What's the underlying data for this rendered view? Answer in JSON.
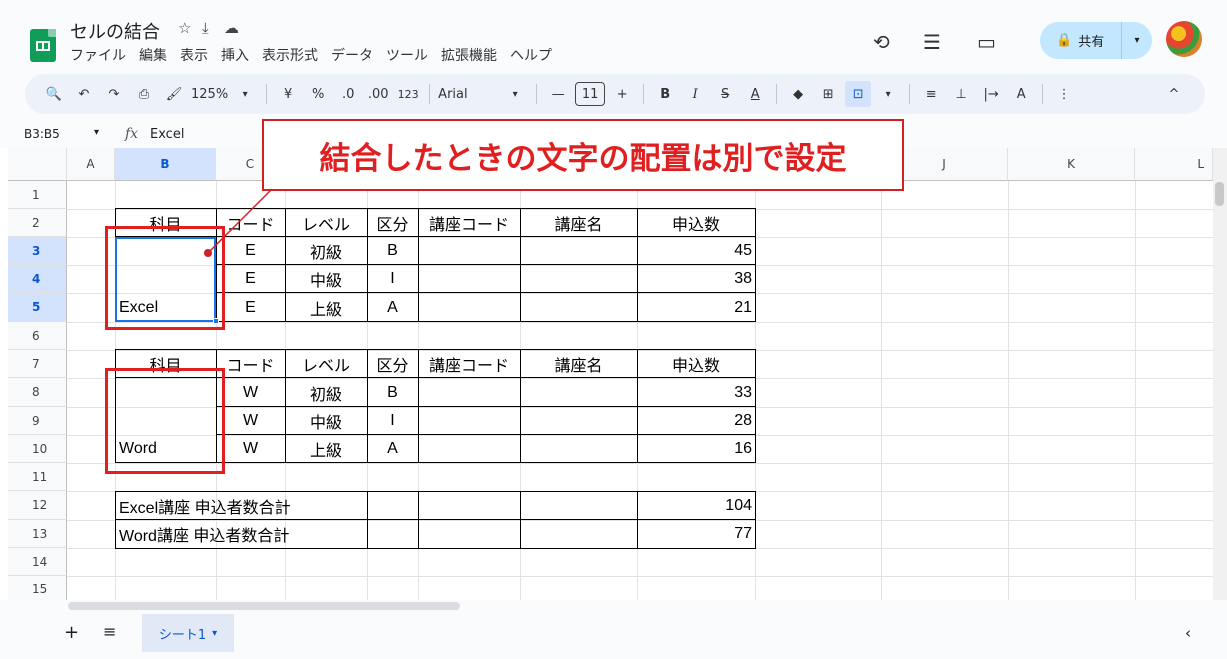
{
  "header": {
    "title": "セルの結合",
    "star": "☆",
    "move": "⤓",
    "cloud": "☁",
    "menu": [
      "ファイル",
      "編集",
      "表示",
      "挿入",
      "表示形式",
      "データ",
      "ツール",
      "拡張機能",
      "ヘルプ"
    ],
    "history": "⟲",
    "comment": "☰",
    "meet": "▭",
    "share_label": "共有",
    "share_arrow": "▾"
  },
  "toolbar": {
    "search": "🔍",
    "undo": "↶",
    "redo": "↷",
    "print": "⎙",
    "paint": "🖌",
    "zoom": "125%",
    "zoom_arrow": "▾",
    "currency": "¥",
    "percent": "%",
    "dec_down": ".0",
    "dec_up": ".00",
    "format123": "123",
    "font": "Arial",
    "font_arrow": "▾",
    "minus": "—",
    "fontsize": "11",
    "plus": "+",
    "bold": "B",
    "italic": "I",
    "strike": "S",
    "textcolor": "A",
    "fill": "◆",
    "borders": "⊞",
    "merge": "⊡",
    "merge_arrow": "▾",
    "align": "≡",
    "valign": "⊥",
    "wrap": "|→",
    "rotate": "A",
    "more": "⋮",
    "collapse": "^"
  },
  "formula": {
    "namebox": "B3:B5",
    "arrow": "▾",
    "fx": "fx",
    "value": "Excel"
  },
  "columns": [
    "A",
    "B",
    "C",
    "",
    "",
    "",
    "",
    "",
    "",
    "J",
    "K",
    "L"
  ],
  "rows": [
    "1",
    "2",
    "3",
    "4",
    "5",
    "6",
    "7",
    "8",
    "9",
    "10",
    "11",
    "12",
    "13",
    "14",
    "15"
  ],
  "table_header": [
    "科目",
    "コード",
    "レベル",
    "区分",
    "講座コード",
    "講座名",
    "申込数"
  ],
  "excel_rows": [
    {
      "code": "E",
      "level": "初級",
      "kubun": "B",
      "count": "45"
    },
    {
      "code": "E",
      "level": "中級",
      "kubun": "I",
      "count": "38"
    },
    {
      "code": "E",
      "level": "上級",
      "kubun": "A",
      "count": "21"
    }
  ],
  "excel_subject": "Excel",
  "word_rows": [
    {
      "code": "W",
      "level": "初級",
      "kubun": "B",
      "count": "33"
    },
    {
      "code": "W",
      "level": "中級",
      "kubun": "I",
      "count": "28"
    },
    {
      "code": "W",
      "level": "上級",
      "kubun": "A",
      "count": "16"
    }
  ],
  "word_subject": "Word",
  "totals": [
    {
      "label": "Excel講座 申込者数合計",
      "value": "104"
    },
    {
      "label": "Word講座 申込者数合計",
      "value": "77"
    }
  ],
  "callout": "結合したときの文字の配置は別で設定",
  "bottom": {
    "add": "+",
    "list": "≡",
    "sheet": "シート1",
    "sheet_arrow": "▾",
    "nav": "‹"
  }
}
